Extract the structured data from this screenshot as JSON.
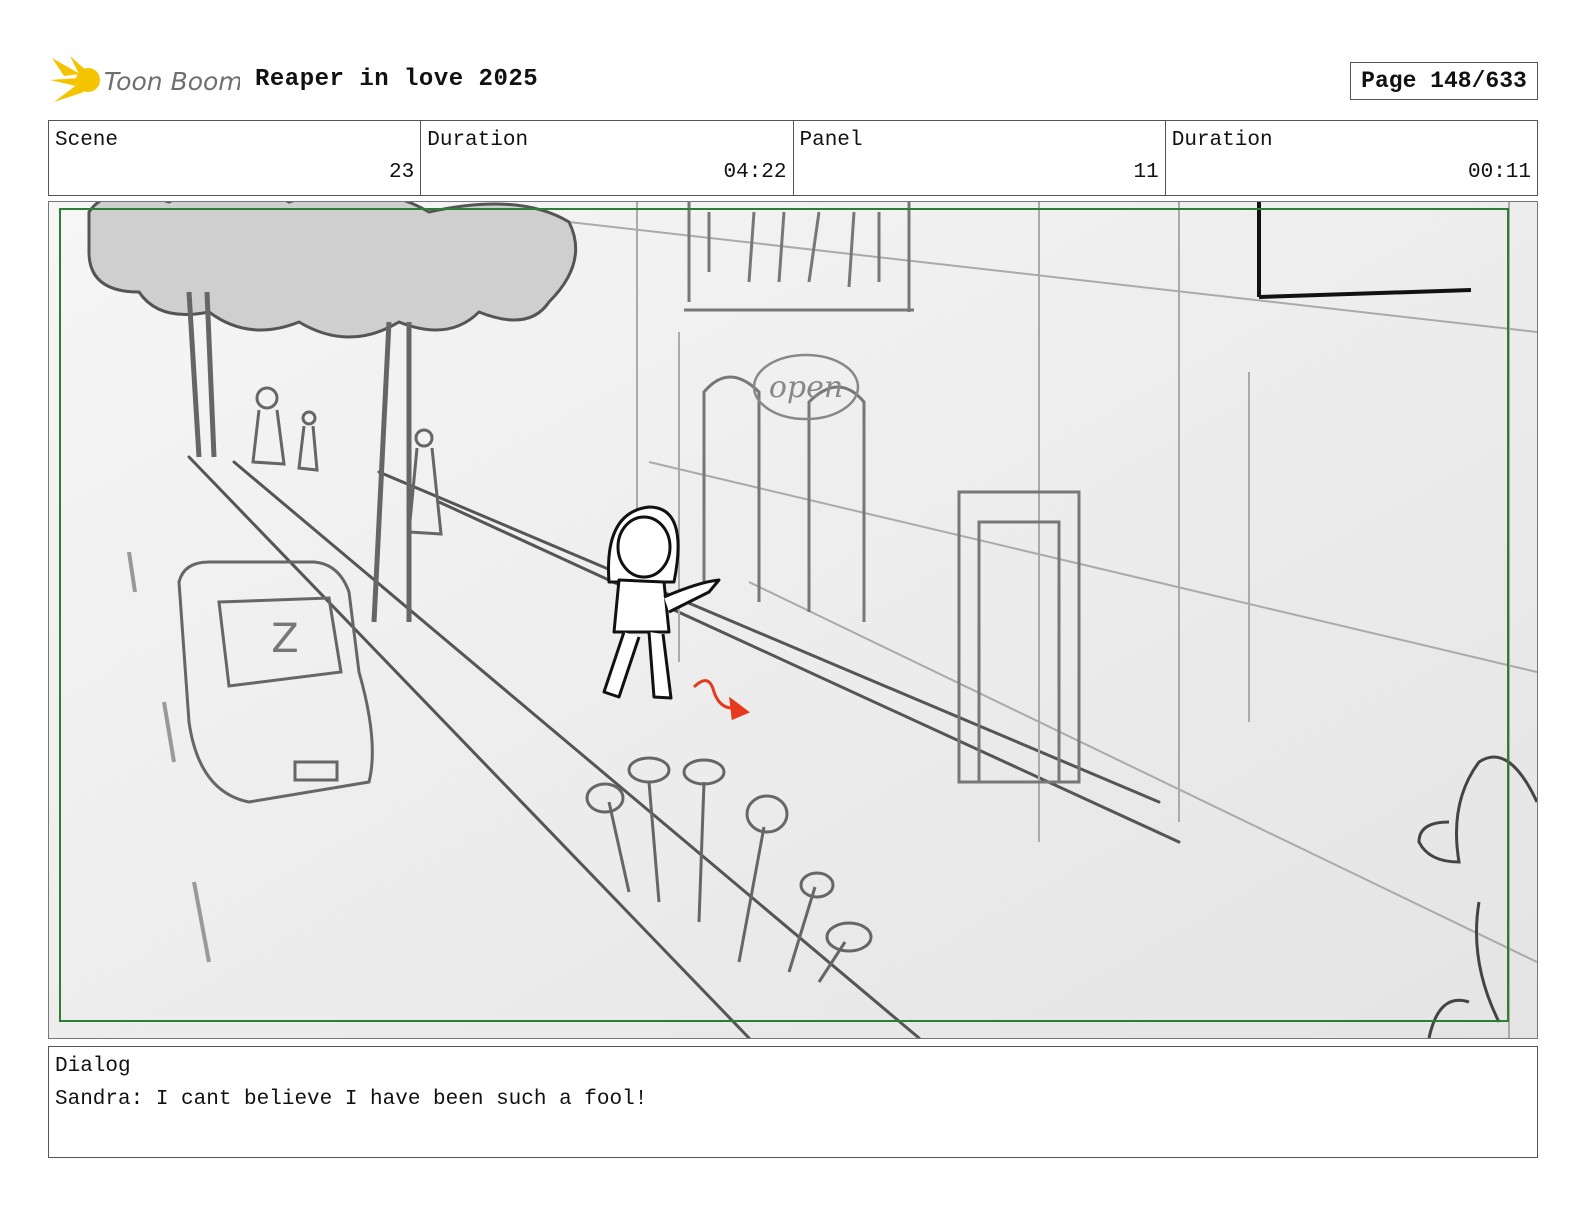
{
  "header": {
    "logo_text": "Toon Boom",
    "project_title": "Reaper in love 2025",
    "page_label": "Page 148/633"
  },
  "info": {
    "scene_label": "Scene",
    "scene_value": "23",
    "scene_duration_label": "Duration",
    "scene_duration_value": "04:22",
    "panel_label": "Panel",
    "panel_value": "11",
    "panel_duration_label": "Duration",
    "panel_duration_value": "00:11"
  },
  "frame": {
    "sign_text": "open",
    "car_plate": "Z"
  },
  "dialog": {
    "label": "Dialog",
    "text": "Sandra: I cant believe I have been such a fool!"
  },
  "colors": {
    "logo_yellow": "#f5c400",
    "logo_text": "#6f6f6f",
    "safe_area": "#2e7d32",
    "motion_arrow": "#e53a1e"
  }
}
